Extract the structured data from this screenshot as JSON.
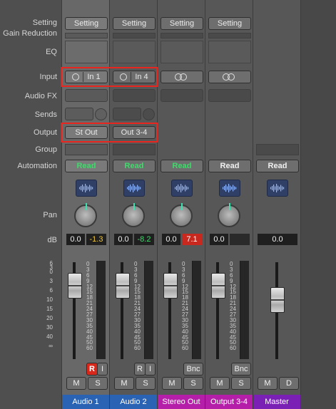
{
  "row_labels": {
    "setting": "Setting",
    "gain_reduction": "Gain Reduction",
    "eq": "EQ",
    "input": "Input",
    "audio_fx": "Audio FX",
    "sends": "Sends",
    "output": "Output",
    "group": "Group",
    "automation": "Automation",
    "pan": "Pan",
    "db": "dB"
  },
  "fader_scale": [
    "6",
    "3",
    "0",
    "3",
    "6",
    "10",
    "15",
    "20",
    "30",
    "40",
    "∞"
  ],
  "meter_scale": [
    "0",
    "3",
    "6",
    "9",
    "12",
    "15",
    "18",
    "21",
    "24",
    "27",
    "30",
    "35",
    "40",
    "45",
    "50",
    "60"
  ],
  "strips": [
    {
      "name": "Audio 1",
      "name_color": "#2a62b4",
      "setting_label": "Setting",
      "input_label": "In 1",
      "output_label": "St Out",
      "automation_label": "Read",
      "automation_color": "green",
      "plugin_icon": "waveform-icon",
      "volume_db": "0.0",
      "peak_db": "-1.3",
      "ri": [
        "R",
        "I"
      ],
      "mute_label": "M",
      "solo_label": "S"
    },
    {
      "name": "Audio 2",
      "name_color": "#2a62b4",
      "setting_label": "Setting",
      "input_label": "In 4",
      "output_label": "Out 3-4",
      "automation_label": "Read",
      "automation_color": "green",
      "plugin_icon": "waveform-icon",
      "volume_db": "0.0",
      "peak_db": "-8.2",
      "ri": [
        "R",
        "I"
      ],
      "mute_label": "M",
      "solo_label": "S"
    },
    {
      "name": "Stereo Out",
      "name_color": "#b51ea8",
      "setting_label": "Setting",
      "automation_label": "Read",
      "automation_color": "green",
      "plugin_icon": "waveform-icon",
      "volume_db": "0.0",
      "peak_db": "7.1",
      "bnc_label": "Bnc",
      "mute_label": "M",
      "solo_label": "S"
    },
    {
      "name": "Output 3-4",
      "name_color": "#b51ea8",
      "setting_label": "Setting",
      "automation_label": "Read",
      "automation_color": "white",
      "plugin_icon": "waveform-icon",
      "volume_db": "0.0",
      "peak_db": "",
      "bnc_label": "Bnc",
      "mute_label": "M",
      "solo_label": "S"
    },
    {
      "name": "Master",
      "name_color": "#7a20b4",
      "automation_label": "Read",
      "automation_color": "white",
      "plugin_icon": "waveform-icon",
      "volume_db": "0.0",
      "mute_label": "M",
      "dim_label": "D"
    }
  ],
  "colors": {
    "highlight_box": "#e8261f",
    "audio_track": "#2a62b4",
    "output_track": "#b51ea8",
    "master_track": "#7a20b4"
  }
}
